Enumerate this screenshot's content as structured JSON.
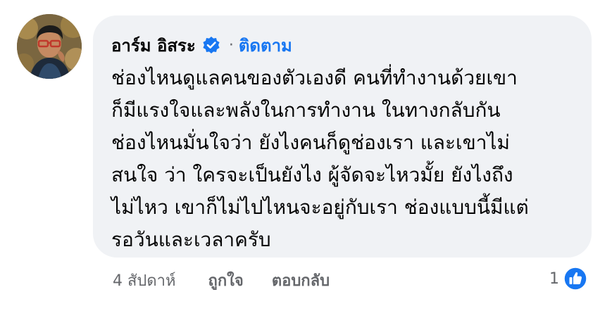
{
  "comment": {
    "author": {
      "name": "อาร์ม อิสระ",
      "verified_icon": "verified-badge-icon",
      "follow_label": "ติดตาม",
      "separator": "·"
    },
    "text_lines": [
      "ช่องไหนดูแลคนของตัวเองดี คนที่ทำงานด้วยเขา",
      "ก็มีแรงใจและพลังในการทำงาน ในทางกลับกัน",
      "ช่องไหนมั่นใจว่า ยังไงคนก็ดูช่องเรา และเขาไม่",
      "สนใจ ว่า ใครจะเป็นยังไง ผู้จัดจะไหวมั้ย ยังไงถึง",
      "ไม่ไหว เขาก็ไม่ไปไหนจะอยู่กับเรา ช่องแบบนี้มีแต่",
      "รอวันและเวลาครับ"
    ],
    "timestamp": "4 สัปดาห์",
    "actions": {
      "like_label": "ถูกใจ",
      "reply_label": "ตอบกลับ"
    },
    "reactions": {
      "count": "1",
      "icon": "like-reaction-icon"
    }
  },
  "colors": {
    "bubble_bg": "#f0f2f5",
    "link_blue": "#1877f2",
    "secondary_text": "#65676b",
    "primary_text": "#050505"
  }
}
